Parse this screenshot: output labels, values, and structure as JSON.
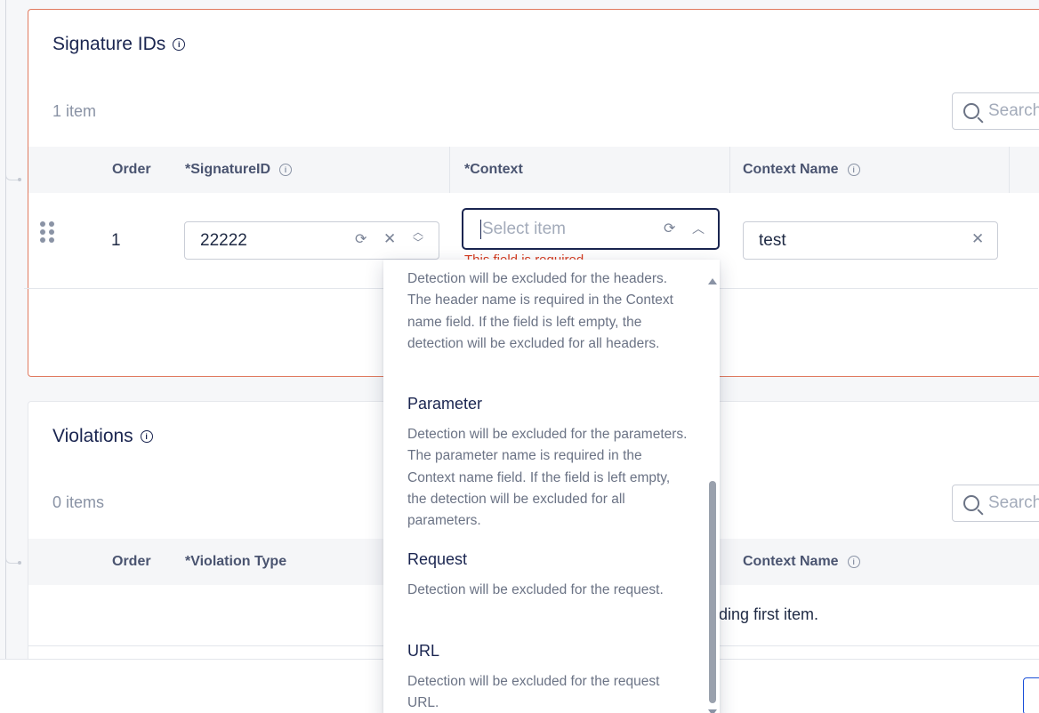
{
  "signature_section": {
    "title": "Signature IDs",
    "count": "1 item",
    "search_placeholder": "Search",
    "columns": {
      "order": "Order",
      "signature_id": "*SignatureID",
      "context": "*Context",
      "context_name": "Context Name"
    },
    "row": {
      "order": "1",
      "signature_id": "22222",
      "context_placeholder": "Select item",
      "context_error": "This field is required",
      "context_name": "test"
    }
  },
  "violations_section": {
    "title": "Violations",
    "count": "0 items",
    "search_placeholder": "Search",
    "columns": {
      "order": "Order",
      "violation_type": "*Violation Type",
      "context_name": "Context Name"
    },
    "empty_message": "ding first item."
  },
  "context_dropdown": {
    "options": [
      {
        "label": "",
        "description": "Detection will be excluded for the headers. The header name is required in the Context name field. If the field is left empty, the detection will be excluded for all headers."
      },
      {
        "label": "Parameter",
        "description": "Detection will be excluded for the parameters. The parameter name is required in the Context name field. If the field is left empty, the detection will be excluded for all parameters."
      },
      {
        "label": "Request",
        "description": "Detection will be excluded for the request."
      },
      {
        "label": "URL",
        "description": "Detection will be excluded for the request URL."
      }
    ]
  },
  "icons": {
    "info": "info-icon",
    "search": "search-icon",
    "refresh": "refresh-icon",
    "clear": "close-icon",
    "drag": "drag-handle-icon",
    "chevron_up": "chevron-up-icon"
  },
  "colors": {
    "error_border": "#e07a5f",
    "error_text": "#d63b1f",
    "title": "#1a2550",
    "muted": "#8a93a5"
  }
}
